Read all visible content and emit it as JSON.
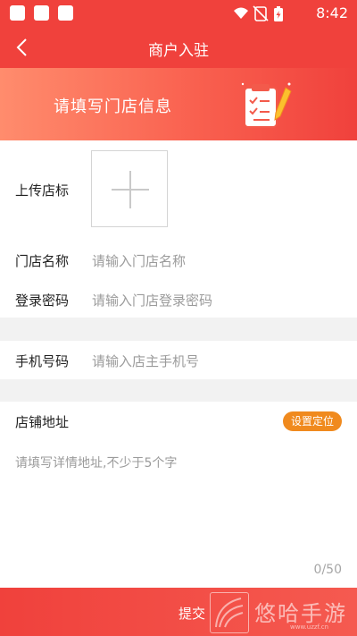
{
  "status_bar": {
    "time": "8:42"
  },
  "nav": {
    "title": "商户入驻"
  },
  "banner": {
    "text": "请填写门店信息"
  },
  "form": {
    "logo_label": "上传店标",
    "store_name_label": "门店名称",
    "store_name_placeholder": "请输入门店名称",
    "password_label": "登录密码",
    "password_placeholder": "请输入门店登录密码",
    "phone_label": "手机号码",
    "phone_placeholder": "请输入店主手机号",
    "address_label": "店铺地址",
    "locate_button": "设置定位",
    "address_placeholder": "请填写详情地址,不少于5个字",
    "counter": "0/50"
  },
  "submit_label": "提交",
  "watermark": {
    "text": "悠哈手游",
    "url": "www.uzzf.cn"
  },
  "colors": {
    "primary": "#f0413c",
    "accent": "#f08a1e",
    "banner_start": "#ff8c6d"
  }
}
